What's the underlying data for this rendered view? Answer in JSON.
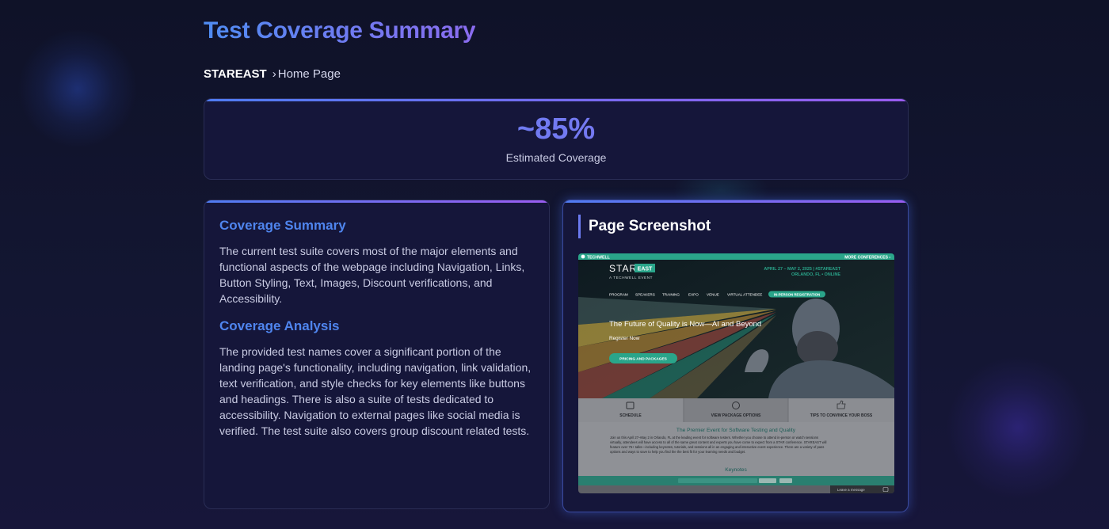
{
  "header": {
    "title": "Test Coverage Summary"
  },
  "breadcrumb": {
    "root": "STAREAST",
    "separator": "›",
    "page": "Home Page"
  },
  "stat": {
    "value": "~85%",
    "label": "Estimated Coverage"
  },
  "summary": {
    "coverage_summary_heading": "Coverage Summary",
    "coverage_summary_text": "The current test suite covers most of the major elements and functional aspects of the webpage including Navigation, Links, Button Styling, Text, Images, Discount verifications, and Accessibility.",
    "coverage_analysis_heading": "Coverage Analysis",
    "coverage_analysis_text": "The provided test names cover a significant portion of the landing page's functionality, including navigation, link validation, text verification, and style checks for key elements like buttons and headings. There is also a suite of tests dedicated to accessibility. Navigation to external pages like social media is verified. The test suite also covers group discount related tests."
  },
  "screenshot_panel": {
    "heading": "Page Screenshot",
    "page": {
      "brand": "TECHWELL",
      "more_conferences": "MORE CONFERENCES ›",
      "logo_star": "STAR",
      "logo_east": "EAST",
      "logo_sub": "A TECHWELL EVENT",
      "dates": "APRIL 27 – MAY 2, 2025 | #STAREAST",
      "location": "ORLANDO, FL • ONLINE",
      "nav": [
        "PROGRAM",
        "SPEAKERS",
        "TRAINING",
        "EXPO",
        "VENUE",
        "VIRTUAL ATTENDEE"
      ],
      "nav_highlight": "IN-PERSON REGISTRATION",
      "hero_headline": "The Future of Quality is Now—AI and Beyond",
      "register_link": "Register Now",
      "pricing_button": "PRICING AND PACKAGES",
      "tiles": [
        "SCHEDULE",
        "VIEW PACKAGE OPTIONS",
        "TIPS TO CONVINCE YOUR BOSS"
      ],
      "premier_heading": "The Premier Event for Software Testing and Quality",
      "premier_text_1": "Join us this April 27–May 2 in Orlando, FL at the leading event for software testers. Whether you choose to attend in-person or watch sessions",
      "premier_text_2": "virtually, attendees will have access to all of the same great content and experts you have come to expect from a STAR conference. STAREAST will",
      "premier_text_3": "feature over 75+ talks—including keynotes, tutorials, and sessions all in an engaging and interactive event experience. There are a variety of pass",
      "premier_text_4": "options and ways to save to help you find the the best fit for your learning needs and budget.",
      "keynotes_heading": "Keynotes",
      "chat_label": "Leave a message"
    },
    "colors": {
      "teal": "#2aa58a",
      "hero_text": "#ffffff",
      "tile_bg": "#8b8d92"
    }
  }
}
